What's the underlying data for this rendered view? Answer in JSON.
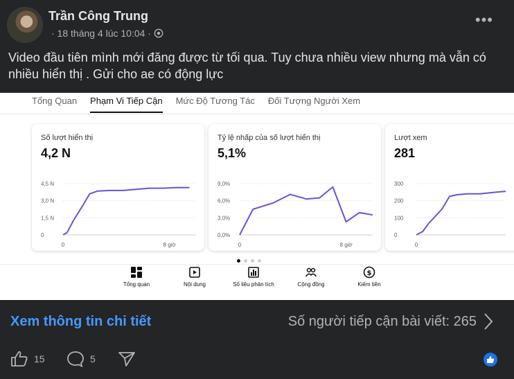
{
  "post": {
    "author": "Trần Công Trung",
    "timestamp": "· 18 tháng 4 lúc 10:04 ·",
    "privacy_icon": "globe-icon",
    "caption": "Video đầu tiên mình mới đăng được từ tối qua. Tuy chưa nhiều view nhưng mà vẫn có nhiều hiển thị . Gửi cho ae có động lực",
    "more": "•••"
  },
  "studio": {
    "tabs": [
      "Tổng Quan",
      "Phạm Vi Tiếp Cận",
      "Mức Độ Tương Tác",
      "Đối Tượng Người Xem"
    ],
    "active_tab": 1,
    "cards": [
      {
        "title": "Số lượt hiển thị",
        "value": "4,2 N"
      },
      {
        "title": "Tỷ lệ nhấp của số lượt hiển thị",
        "value": "5,1%"
      },
      {
        "title": "Lượt xem",
        "value": "281"
      }
    ],
    "nav": [
      {
        "label": "Tổng quan",
        "icon": "dashboard-icon"
      },
      {
        "label": "Nội dung",
        "icon": "content-icon"
      },
      {
        "label": "Số liệu phân tích",
        "icon": "analytics-icon"
      },
      {
        "label": "Cộng đồng",
        "icon": "community-icon"
      },
      {
        "label": "Kiếm tiền",
        "icon": "earn-icon"
      }
    ]
  },
  "chart_data": [
    {
      "type": "line",
      "title": "Số lượt hiển thị",
      "x_ticks": [
        "0",
        "8 giờ"
      ],
      "y_ticks": [
        "0",
        "1,5 N",
        "3,0 N",
        "4,5 N"
      ],
      "ylim": [
        0,
        4.5
      ],
      "xlim": [
        0,
        10
      ],
      "x": [
        0,
        0.3,
        0.8,
        1.5,
        2.0,
        2.6,
        3.5,
        4.5,
        5.5,
        6.5,
        7.5,
        8.5,
        9.5
      ],
      "y": [
        0,
        0.2,
        1.3,
        2.6,
        3.6,
        3.85,
        3.9,
        3.9,
        4.0,
        4.1,
        4.1,
        4.15,
        4.15
      ],
      "color": "#6d4fd8",
      "grid": true
    },
    {
      "type": "line",
      "title": "Tỷ lệ nhấp của số lượt hiển thị",
      "x_ticks": [
        "0",
        "8 giờ"
      ],
      "y_ticks": [
        "0,0%",
        "3,0%",
        "6,0%",
        "9,0%"
      ],
      "ylim": [
        0,
        9
      ],
      "xlim": [
        0,
        10
      ],
      "x": [
        0,
        1,
        2.5,
        3.8,
        5,
        6,
        7,
        8,
        9,
        10
      ],
      "y": [
        0,
        4.5,
        5.6,
        7.1,
        6.3,
        6.5,
        8.4,
        2.3,
        3.9,
        3.5
      ],
      "color": "#6d4fd8",
      "grid": true
    },
    {
      "type": "line",
      "title": "Lượt xem",
      "x_ticks": [
        "0"
      ],
      "y_ticks": [
        "0",
        "100",
        "200",
        "300"
      ],
      "ylim": [
        0,
        300
      ],
      "xlim": [
        0,
        7
      ],
      "x": [
        0,
        0.5,
        1.0,
        1.5,
        2.0,
        2.6,
        3.2,
        4.0,
        5.0,
        6.0,
        7.0
      ],
      "y": [
        0,
        20,
        70,
        110,
        150,
        225,
        235,
        240,
        240,
        248,
        255
      ],
      "color": "#6d4fd8",
      "grid": true
    }
  ],
  "footer": {
    "details_link": "Xem thông tin chi tiết",
    "reach_text": "Số người tiếp cận bài viết: 265",
    "likes": "15",
    "comments": "5"
  }
}
